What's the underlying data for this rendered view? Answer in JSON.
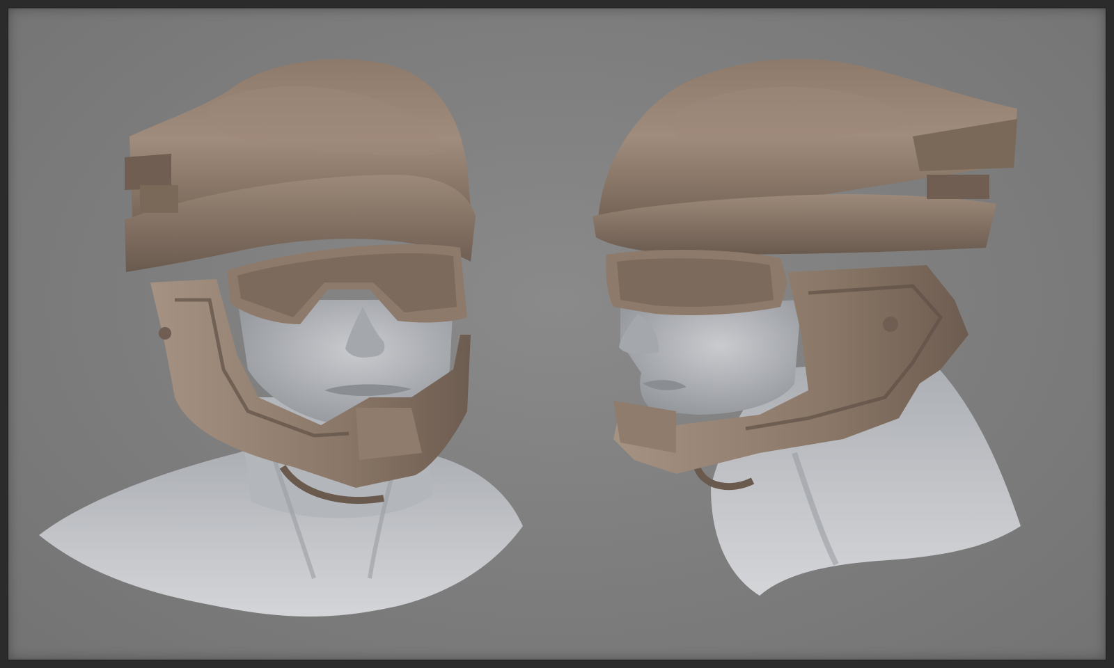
{
  "scene": {
    "description_kind": "3d-sculpt-render",
    "views": [
      {
        "id": "view-front-three-quarter",
        "subject": "helmeted-bust"
      },
      {
        "id": "view-side-profile",
        "subject": "helmeted-bust"
      }
    ],
    "colors": {
      "frame": "#2b2b2b",
      "background": "#7d7d7d",
      "helmet": "#8a7666",
      "helmet_light": "#a38f7e",
      "helmet_dark": "#5f5046",
      "skin": "#b9bbbf",
      "skin_light": "#d6d8dc",
      "skin_dark": "#8a8c91"
    }
  }
}
